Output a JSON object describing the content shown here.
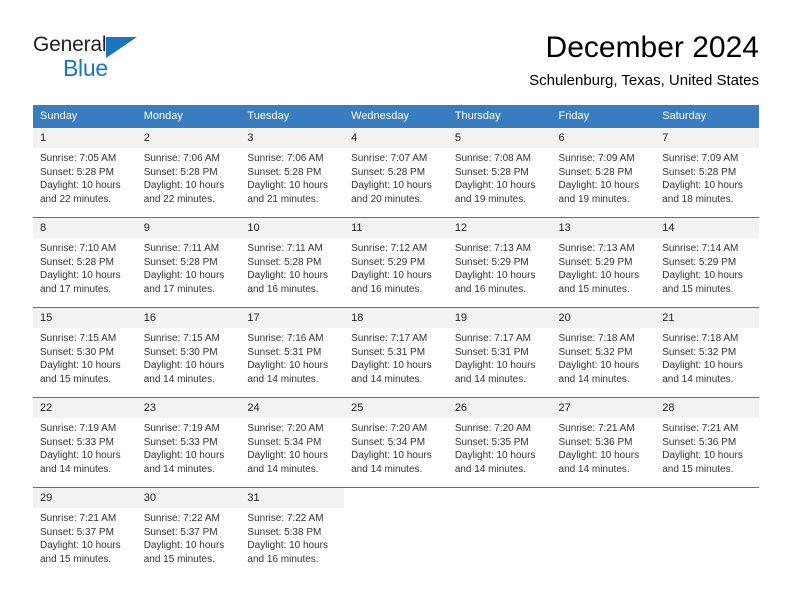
{
  "logo": {
    "word1": "General",
    "word2": "Blue",
    "triangle_color": "#1b75bb",
    "text_color": "#231f20"
  },
  "header": {
    "title": "December 2024",
    "subtitle": "Schulenburg, Texas, United States"
  },
  "theme": {
    "header_bg": "#3a7cc0",
    "header_text": "#ffffff",
    "daynum_bg": "#f2f2f2",
    "grid_line": "#3a7cc0",
    "body_text": "#333333"
  },
  "weekday_headers": [
    "Sunday",
    "Monday",
    "Tuesday",
    "Wednesday",
    "Thursday",
    "Friday",
    "Saturday"
  ],
  "labels": {
    "sunrise_prefix": "Sunrise:",
    "sunset_prefix": "Sunset:",
    "daylight_prefix": "Daylight:"
  },
  "weeks": [
    [
      {
        "day": "1",
        "sunrise": "Sunrise: 7:05 AM",
        "sunset": "Sunset: 5:28 PM",
        "daylight_line1": "Daylight: 10 hours",
        "daylight_line2": "and 22 minutes."
      },
      {
        "day": "2",
        "sunrise": "Sunrise: 7:06 AM",
        "sunset": "Sunset: 5:28 PM",
        "daylight_line1": "Daylight: 10 hours",
        "daylight_line2": "and 22 minutes."
      },
      {
        "day": "3",
        "sunrise": "Sunrise: 7:06 AM",
        "sunset": "Sunset: 5:28 PM",
        "daylight_line1": "Daylight: 10 hours",
        "daylight_line2": "and 21 minutes."
      },
      {
        "day": "4",
        "sunrise": "Sunrise: 7:07 AM",
        "sunset": "Sunset: 5:28 PM",
        "daylight_line1": "Daylight: 10 hours",
        "daylight_line2": "and 20 minutes."
      },
      {
        "day": "5",
        "sunrise": "Sunrise: 7:08 AM",
        "sunset": "Sunset: 5:28 PM",
        "daylight_line1": "Daylight: 10 hours",
        "daylight_line2": "and 19 minutes."
      },
      {
        "day": "6",
        "sunrise": "Sunrise: 7:09 AM",
        "sunset": "Sunset: 5:28 PM",
        "daylight_line1": "Daylight: 10 hours",
        "daylight_line2": "and 19 minutes."
      },
      {
        "day": "7",
        "sunrise": "Sunrise: 7:09 AM",
        "sunset": "Sunset: 5:28 PM",
        "daylight_line1": "Daylight: 10 hours",
        "daylight_line2": "and 18 minutes."
      }
    ],
    [
      {
        "day": "8",
        "sunrise": "Sunrise: 7:10 AM",
        "sunset": "Sunset: 5:28 PM",
        "daylight_line1": "Daylight: 10 hours",
        "daylight_line2": "and 17 minutes."
      },
      {
        "day": "9",
        "sunrise": "Sunrise: 7:11 AM",
        "sunset": "Sunset: 5:28 PM",
        "daylight_line1": "Daylight: 10 hours",
        "daylight_line2": "and 17 minutes."
      },
      {
        "day": "10",
        "sunrise": "Sunrise: 7:11 AM",
        "sunset": "Sunset: 5:28 PM",
        "daylight_line1": "Daylight: 10 hours",
        "daylight_line2": "and 16 minutes."
      },
      {
        "day": "11",
        "sunrise": "Sunrise: 7:12 AM",
        "sunset": "Sunset: 5:29 PM",
        "daylight_line1": "Daylight: 10 hours",
        "daylight_line2": "and 16 minutes."
      },
      {
        "day": "12",
        "sunrise": "Sunrise: 7:13 AM",
        "sunset": "Sunset: 5:29 PM",
        "daylight_line1": "Daylight: 10 hours",
        "daylight_line2": "and 16 minutes."
      },
      {
        "day": "13",
        "sunrise": "Sunrise: 7:13 AM",
        "sunset": "Sunset: 5:29 PM",
        "daylight_line1": "Daylight: 10 hours",
        "daylight_line2": "and 15 minutes."
      },
      {
        "day": "14",
        "sunrise": "Sunrise: 7:14 AM",
        "sunset": "Sunset: 5:29 PM",
        "daylight_line1": "Daylight: 10 hours",
        "daylight_line2": "and 15 minutes."
      }
    ],
    [
      {
        "day": "15",
        "sunrise": "Sunrise: 7:15 AM",
        "sunset": "Sunset: 5:30 PM",
        "daylight_line1": "Daylight: 10 hours",
        "daylight_line2": "and 15 minutes."
      },
      {
        "day": "16",
        "sunrise": "Sunrise: 7:15 AM",
        "sunset": "Sunset: 5:30 PM",
        "daylight_line1": "Daylight: 10 hours",
        "daylight_line2": "and 14 minutes."
      },
      {
        "day": "17",
        "sunrise": "Sunrise: 7:16 AM",
        "sunset": "Sunset: 5:31 PM",
        "daylight_line1": "Daylight: 10 hours",
        "daylight_line2": "and 14 minutes."
      },
      {
        "day": "18",
        "sunrise": "Sunrise: 7:17 AM",
        "sunset": "Sunset: 5:31 PM",
        "daylight_line1": "Daylight: 10 hours",
        "daylight_line2": "and 14 minutes."
      },
      {
        "day": "19",
        "sunrise": "Sunrise: 7:17 AM",
        "sunset": "Sunset: 5:31 PM",
        "daylight_line1": "Daylight: 10 hours",
        "daylight_line2": "and 14 minutes."
      },
      {
        "day": "20",
        "sunrise": "Sunrise: 7:18 AM",
        "sunset": "Sunset: 5:32 PM",
        "daylight_line1": "Daylight: 10 hours",
        "daylight_line2": "and 14 minutes."
      },
      {
        "day": "21",
        "sunrise": "Sunrise: 7:18 AM",
        "sunset": "Sunset: 5:32 PM",
        "daylight_line1": "Daylight: 10 hours",
        "daylight_line2": "and 14 minutes."
      }
    ],
    [
      {
        "day": "22",
        "sunrise": "Sunrise: 7:19 AM",
        "sunset": "Sunset: 5:33 PM",
        "daylight_line1": "Daylight: 10 hours",
        "daylight_line2": "and 14 minutes."
      },
      {
        "day": "23",
        "sunrise": "Sunrise: 7:19 AM",
        "sunset": "Sunset: 5:33 PM",
        "daylight_line1": "Daylight: 10 hours",
        "daylight_line2": "and 14 minutes."
      },
      {
        "day": "24",
        "sunrise": "Sunrise: 7:20 AM",
        "sunset": "Sunset: 5:34 PM",
        "daylight_line1": "Daylight: 10 hours",
        "daylight_line2": "and 14 minutes."
      },
      {
        "day": "25",
        "sunrise": "Sunrise: 7:20 AM",
        "sunset": "Sunset: 5:34 PM",
        "daylight_line1": "Daylight: 10 hours",
        "daylight_line2": "and 14 minutes."
      },
      {
        "day": "26",
        "sunrise": "Sunrise: 7:20 AM",
        "sunset": "Sunset: 5:35 PM",
        "daylight_line1": "Daylight: 10 hours",
        "daylight_line2": "and 14 minutes."
      },
      {
        "day": "27",
        "sunrise": "Sunrise: 7:21 AM",
        "sunset": "Sunset: 5:36 PM",
        "daylight_line1": "Daylight: 10 hours",
        "daylight_line2": "and 14 minutes."
      },
      {
        "day": "28",
        "sunrise": "Sunrise: 7:21 AM",
        "sunset": "Sunset: 5:36 PM",
        "daylight_line1": "Daylight: 10 hours",
        "daylight_line2": "and 15 minutes."
      }
    ],
    [
      {
        "day": "29",
        "sunrise": "Sunrise: 7:21 AM",
        "sunset": "Sunset: 5:37 PM",
        "daylight_line1": "Daylight: 10 hours",
        "daylight_line2": "and 15 minutes."
      },
      {
        "day": "30",
        "sunrise": "Sunrise: 7:22 AM",
        "sunset": "Sunset: 5:37 PM",
        "daylight_line1": "Daylight: 10 hours",
        "daylight_line2": "and 15 minutes."
      },
      {
        "day": "31",
        "sunrise": "Sunrise: 7:22 AM",
        "sunset": "Sunset: 5:38 PM",
        "daylight_line1": "Daylight: 10 hours",
        "daylight_line2": "and 16 minutes."
      },
      {
        "day": "",
        "sunrise": "",
        "sunset": "",
        "daylight_line1": "",
        "daylight_line2": ""
      },
      {
        "day": "",
        "sunrise": "",
        "sunset": "",
        "daylight_line1": "",
        "daylight_line2": ""
      },
      {
        "day": "",
        "sunrise": "",
        "sunset": "",
        "daylight_line1": "",
        "daylight_line2": ""
      },
      {
        "day": "",
        "sunrise": "",
        "sunset": "",
        "daylight_line1": "",
        "daylight_line2": ""
      }
    ]
  ]
}
